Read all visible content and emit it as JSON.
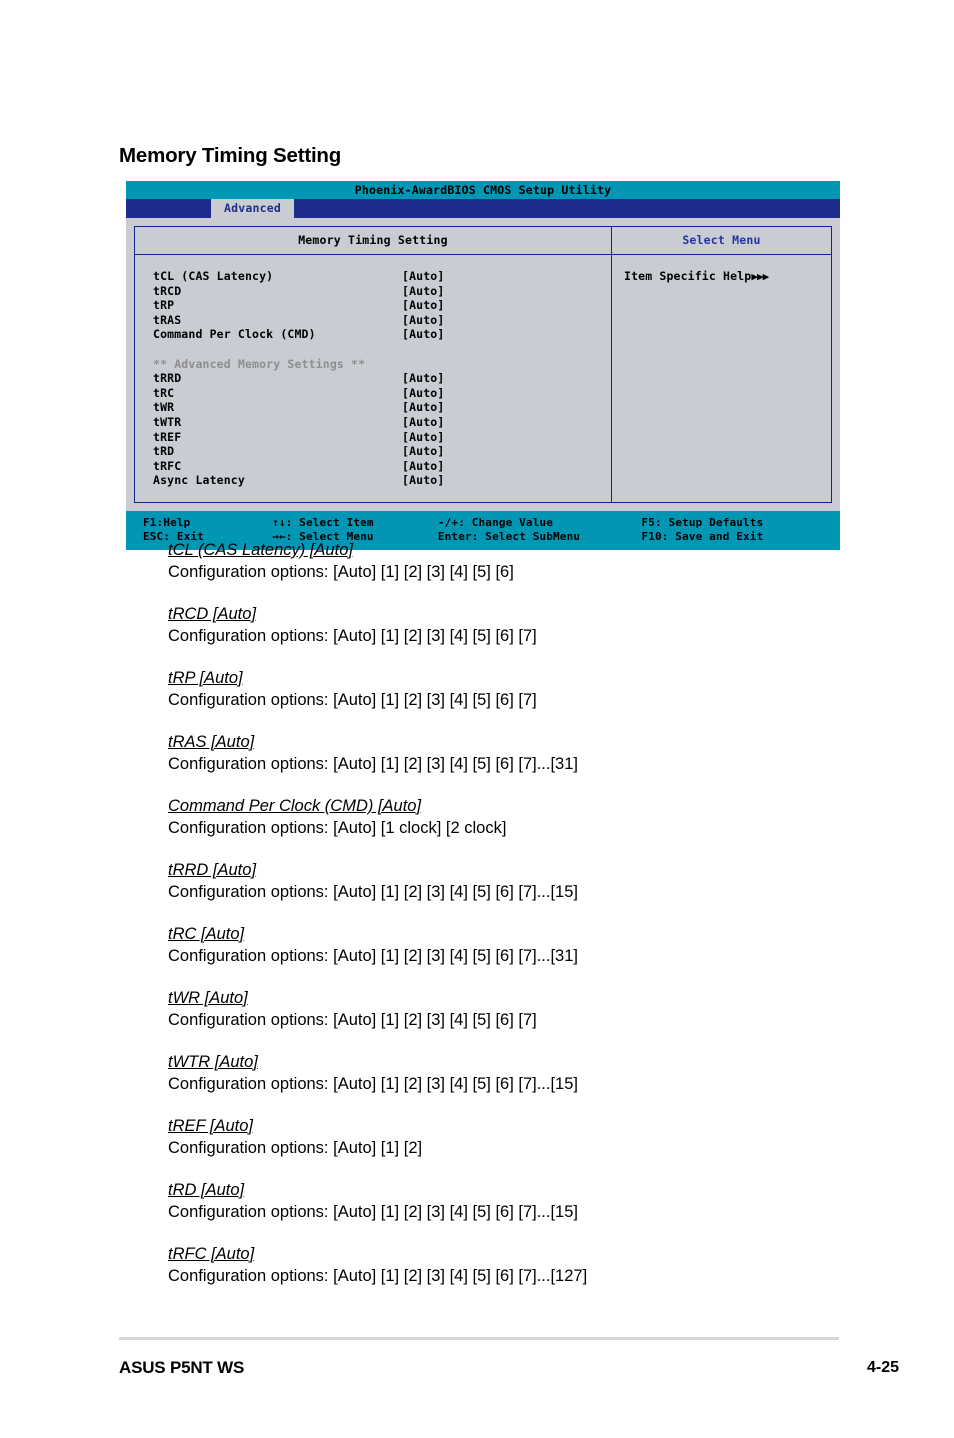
{
  "section": {
    "title": "Memory Timing Setting"
  },
  "bios": {
    "utility_title": "Phoenix-AwardBIOS CMOS Setup Utility",
    "active_tab": "Advanced",
    "left_panel_header": "Memory Timing Setting",
    "right_panel_header": "Select Menu",
    "help_text": "Item Specific Help",
    "help_arrows": "▶▶▶",
    "items": [
      {
        "label": "tCL (CAS Latency)",
        "value": "[Auto]",
        "type": "option"
      },
      {
        "label": "tRCD",
        "value": "[Auto]",
        "type": "option"
      },
      {
        "label": "tRP",
        "value": "[Auto]",
        "type": "option"
      },
      {
        "label": "tRAS",
        "value": "[Auto]",
        "type": "option"
      },
      {
        "label": "Command Per Clock (CMD)",
        "value": "[Auto]",
        "type": "option"
      },
      {
        "label": "",
        "value": "",
        "type": "spacer"
      },
      {
        "label": "** Advanced Memory Settings **",
        "value": "",
        "type": "heading"
      },
      {
        "label": "tRRD",
        "value": "[Auto]",
        "type": "option"
      },
      {
        "label": "tRC",
        "value": "[Auto]",
        "type": "option"
      },
      {
        "label": "tWR",
        "value": "[Auto]",
        "type": "option"
      },
      {
        "label": "tWTR",
        "value": "[Auto]",
        "type": "option"
      },
      {
        "label": "tREF",
        "value": "[Auto]",
        "type": "option"
      },
      {
        "label": "tRD",
        "value": "[Auto]",
        "type": "option"
      },
      {
        "label": "tRFC",
        "value": "[Auto]",
        "type": "option"
      },
      {
        "label": "Async Latency",
        "value": "[Auto]",
        "type": "option"
      }
    ],
    "footer": {
      "row1": [
        "F1:Help",
        "↑↓: Select Item",
        "-/+: Change Value",
        "F5: Setup Defaults"
      ],
      "row2": [
        "ESC: Exit",
        "→←: Select Menu",
        "Enter: Select SubMenu",
        "F10: Save and Exit"
      ]
    }
  },
  "descriptions": [
    {
      "title": "tCL (CAS Latency) [Auto]",
      "options": "Configuration options: [Auto] [1] [2] [3] [4] [5] [6]"
    },
    {
      "title": "tRCD [Auto]",
      "options": "Configuration options: [Auto] [1] [2] [3] [4] [5] [6] [7]"
    },
    {
      "title": "tRP [Auto]",
      "options": "Configuration options: [Auto] [1] [2] [3] [4] [5] [6] [7]"
    },
    {
      "title": "tRAS [Auto]",
      "options": "Configuration options: [Auto] [1] [2] [3] [4] [5] [6] [7]...[31]"
    },
    {
      "title": "Command Per Clock (CMD) [Auto]",
      "options": "Configuration options: [Auto] [1 clock] [2 clock]"
    },
    {
      "title": "tRRD [Auto]",
      "options": "Configuration options: [Auto] [1] [2] [3] [4] [5] [6] [7]...[15]"
    },
    {
      "title": "tRC [Auto]",
      "options": "Configuration options: [Auto] [1] [2] [3] [4] [5] [6] [7]...[31]"
    },
    {
      "title": "tWR [Auto]",
      "options": "Configuration options: [Auto] [1] [2] [3] [4] [5] [6] [7]"
    },
    {
      "title": "tWTR [Auto]",
      "options": "Configuration options: [Auto] [1] [2] [3] [4] [5] [6] [7]...[15]"
    },
    {
      "title": "tREF [Auto]",
      "options": "Configuration options: [Auto] [1] [2]"
    },
    {
      "title": "tRD [Auto]",
      "options": "Configuration options: [Auto] [1] [2] [3] [4] [5] [6] [7]...[15]"
    },
    {
      "title": "tRFC [Auto]",
      "options": "Configuration options: [Auto] [1] [2] [3] [4] [5] [6] [7]...[127]"
    }
  ],
  "page_footer": {
    "product": "ASUS P5NT WS",
    "page_number": "4-25"
  },
  "colors": {
    "bios_title_bar": "#0096b4",
    "bios_menu_bar": "#1e2d8c",
    "bios_panel_bg": "#c9ccd2",
    "bios_border": "#14238c",
    "bios_heading_gray": "#8e8e8e",
    "footer_rule": "#d6d6d6"
  }
}
